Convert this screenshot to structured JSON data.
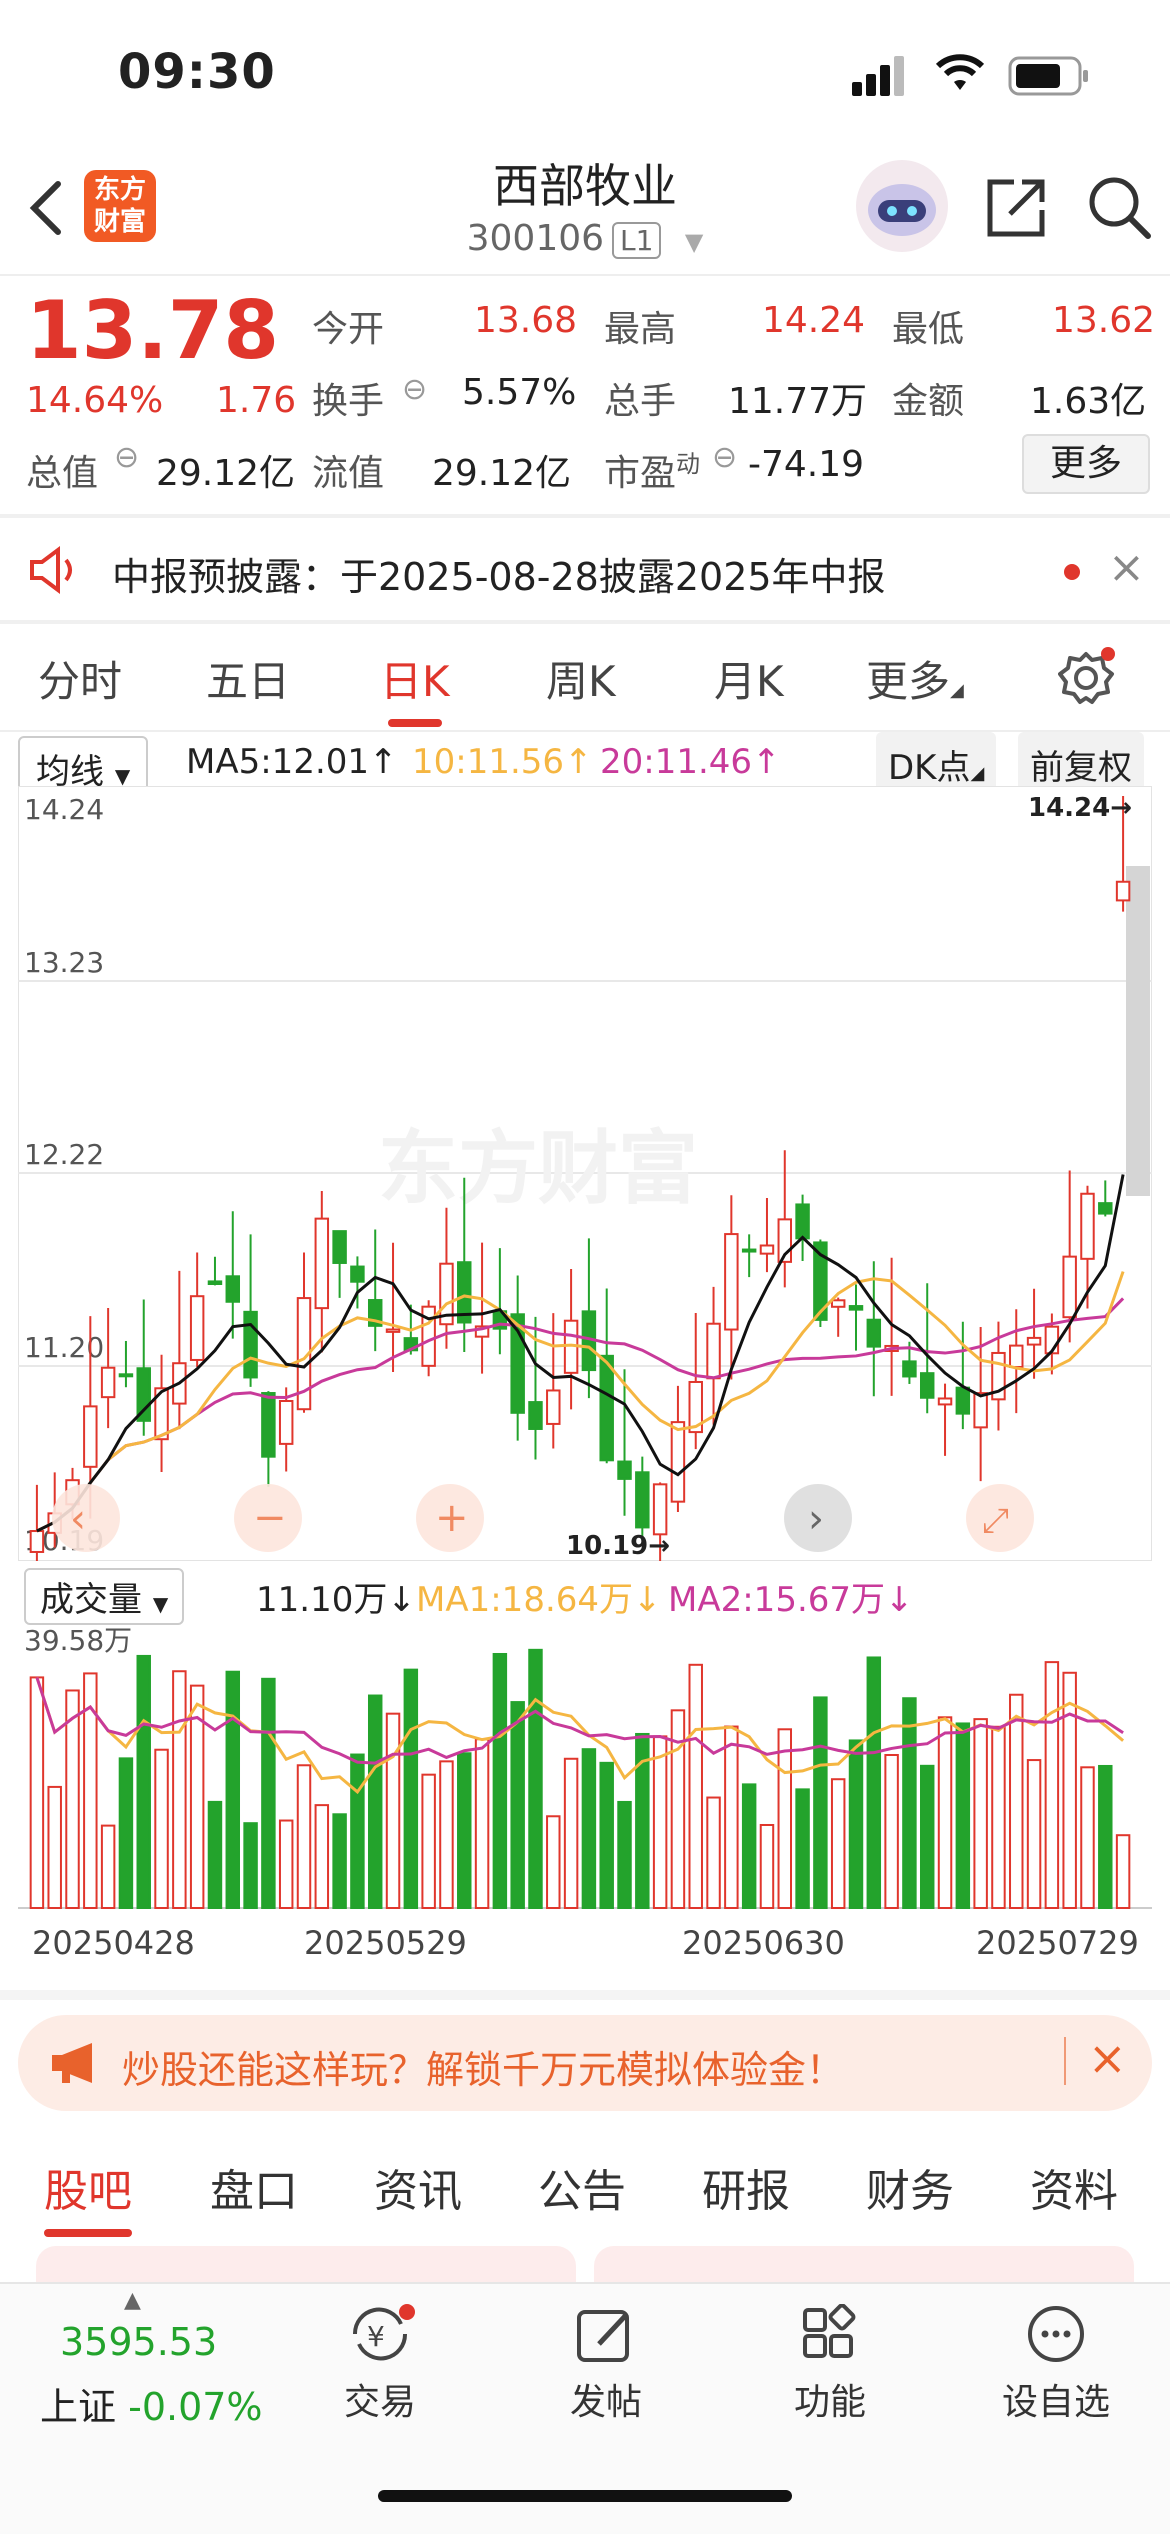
{
  "status": {
    "time": "09:30"
  },
  "header": {
    "title": "西部牧业",
    "code": "300106",
    "level": "L1",
    "logo_text": "东方财富"
  },
  "quote": {
    "price": "13.78",
    "change_pct": "14.64%",
    "change_amt": "1.76",
    "open_label": "今开",
    "open": "13.68",
    "high_label": "最高",
    "high": "14.24",
    "low_label": "最低",
    "low": "13.62",
    "turnover_label": "换手",
    "turnover": "5.57%",
    "volume_label": "总手",
    "volume": "11.77万",
    "amount_label": "金额",
    "amount": "1.63亿",
    "mktcap_label": "总值",
    "mktcap": "29.12亿",
    "float_label": "流值",
    "float": "29.12亿",
    "pe_label": "市盈",
    "pe_sup": "动",
    "pe": "-74.19",
    "more": "更多"
  },
  "notice": {
    "text": "中报预披露：于2025-08-28披露2025年中报"
  },
  "tabs": [
    {
      "label": "分时"
    },
    {
      "label": "五日"
    },
    {
      "label": "日K"
    },
    {
      "label": "周K"
    },
    {
      "label": "月K"
    },
    {
      "label": "更多"
    }
  ],
  "chart_toolbar": {
    "ma_select": "均线",
    "ma5": "MA5:12.01",
    "ma10": "10:11.56",
    "ma20": "20:11.46",
    "dk": "DK点",
    "adjust": "前复权",
    "arrow_up": "↑"
  },
  "vol_toolbar": {
    "select": "成交量",
    "vol": "11.10万",
    "ma1": "MA1:18.64万",
    "ma2": "MA2:15.67万",
    "arrow_down": "↓"
  },
  "chart_data": {
    "type": "candlestick",
    "y_ticks": [
      "14.24",
      "13.23",
      "12.22",
      "11.20",
      "10.19"
    ],
    "ylim": [
      10.19,
      14.24
    ],
    "annotations": {
      "high": "14.24→",
      "low": "10.19→"
    },
    "watermark": "东方财富",
    "volume_max_label": "39.58万",
    "x_ticks": [
      "20250428",
      "20250529",
      "20250630",
      "20250729"
    ],
    "colors": {
      "up": "#e0362c",
      "down": "#23a32c",
      "ma5": "#111111",
      "ma10": "#f5b642",
      "ma20": "#c83a9a"
    }
  },
  "banner": {
    "text": "炒股还能这样玩？解锁千万元模拟体验金！"
  },
  "bottom_tabs": [
    {
      "label": "股吧"
    },
    {
      "label": "盘口"
    },
    {
      "label": "资讯"
    },
    {
      "label": "公告"
    },
    {
      "label": "研报"
    },
    {
      "label": "财务"
    },
    {
      "label": "资料"
    }
  ],
  "footer": {
    "index_value": "3595.53",
    "index_name": "上证",
    "index_change": "-0.07%",
    "items": [
      {
        "label": "交易"
      },
      {
        "label": "发帖"
      },
      {
        "label": "功能"
      },
      {
        "label": "设自选"
      }
    ]
  }
}
